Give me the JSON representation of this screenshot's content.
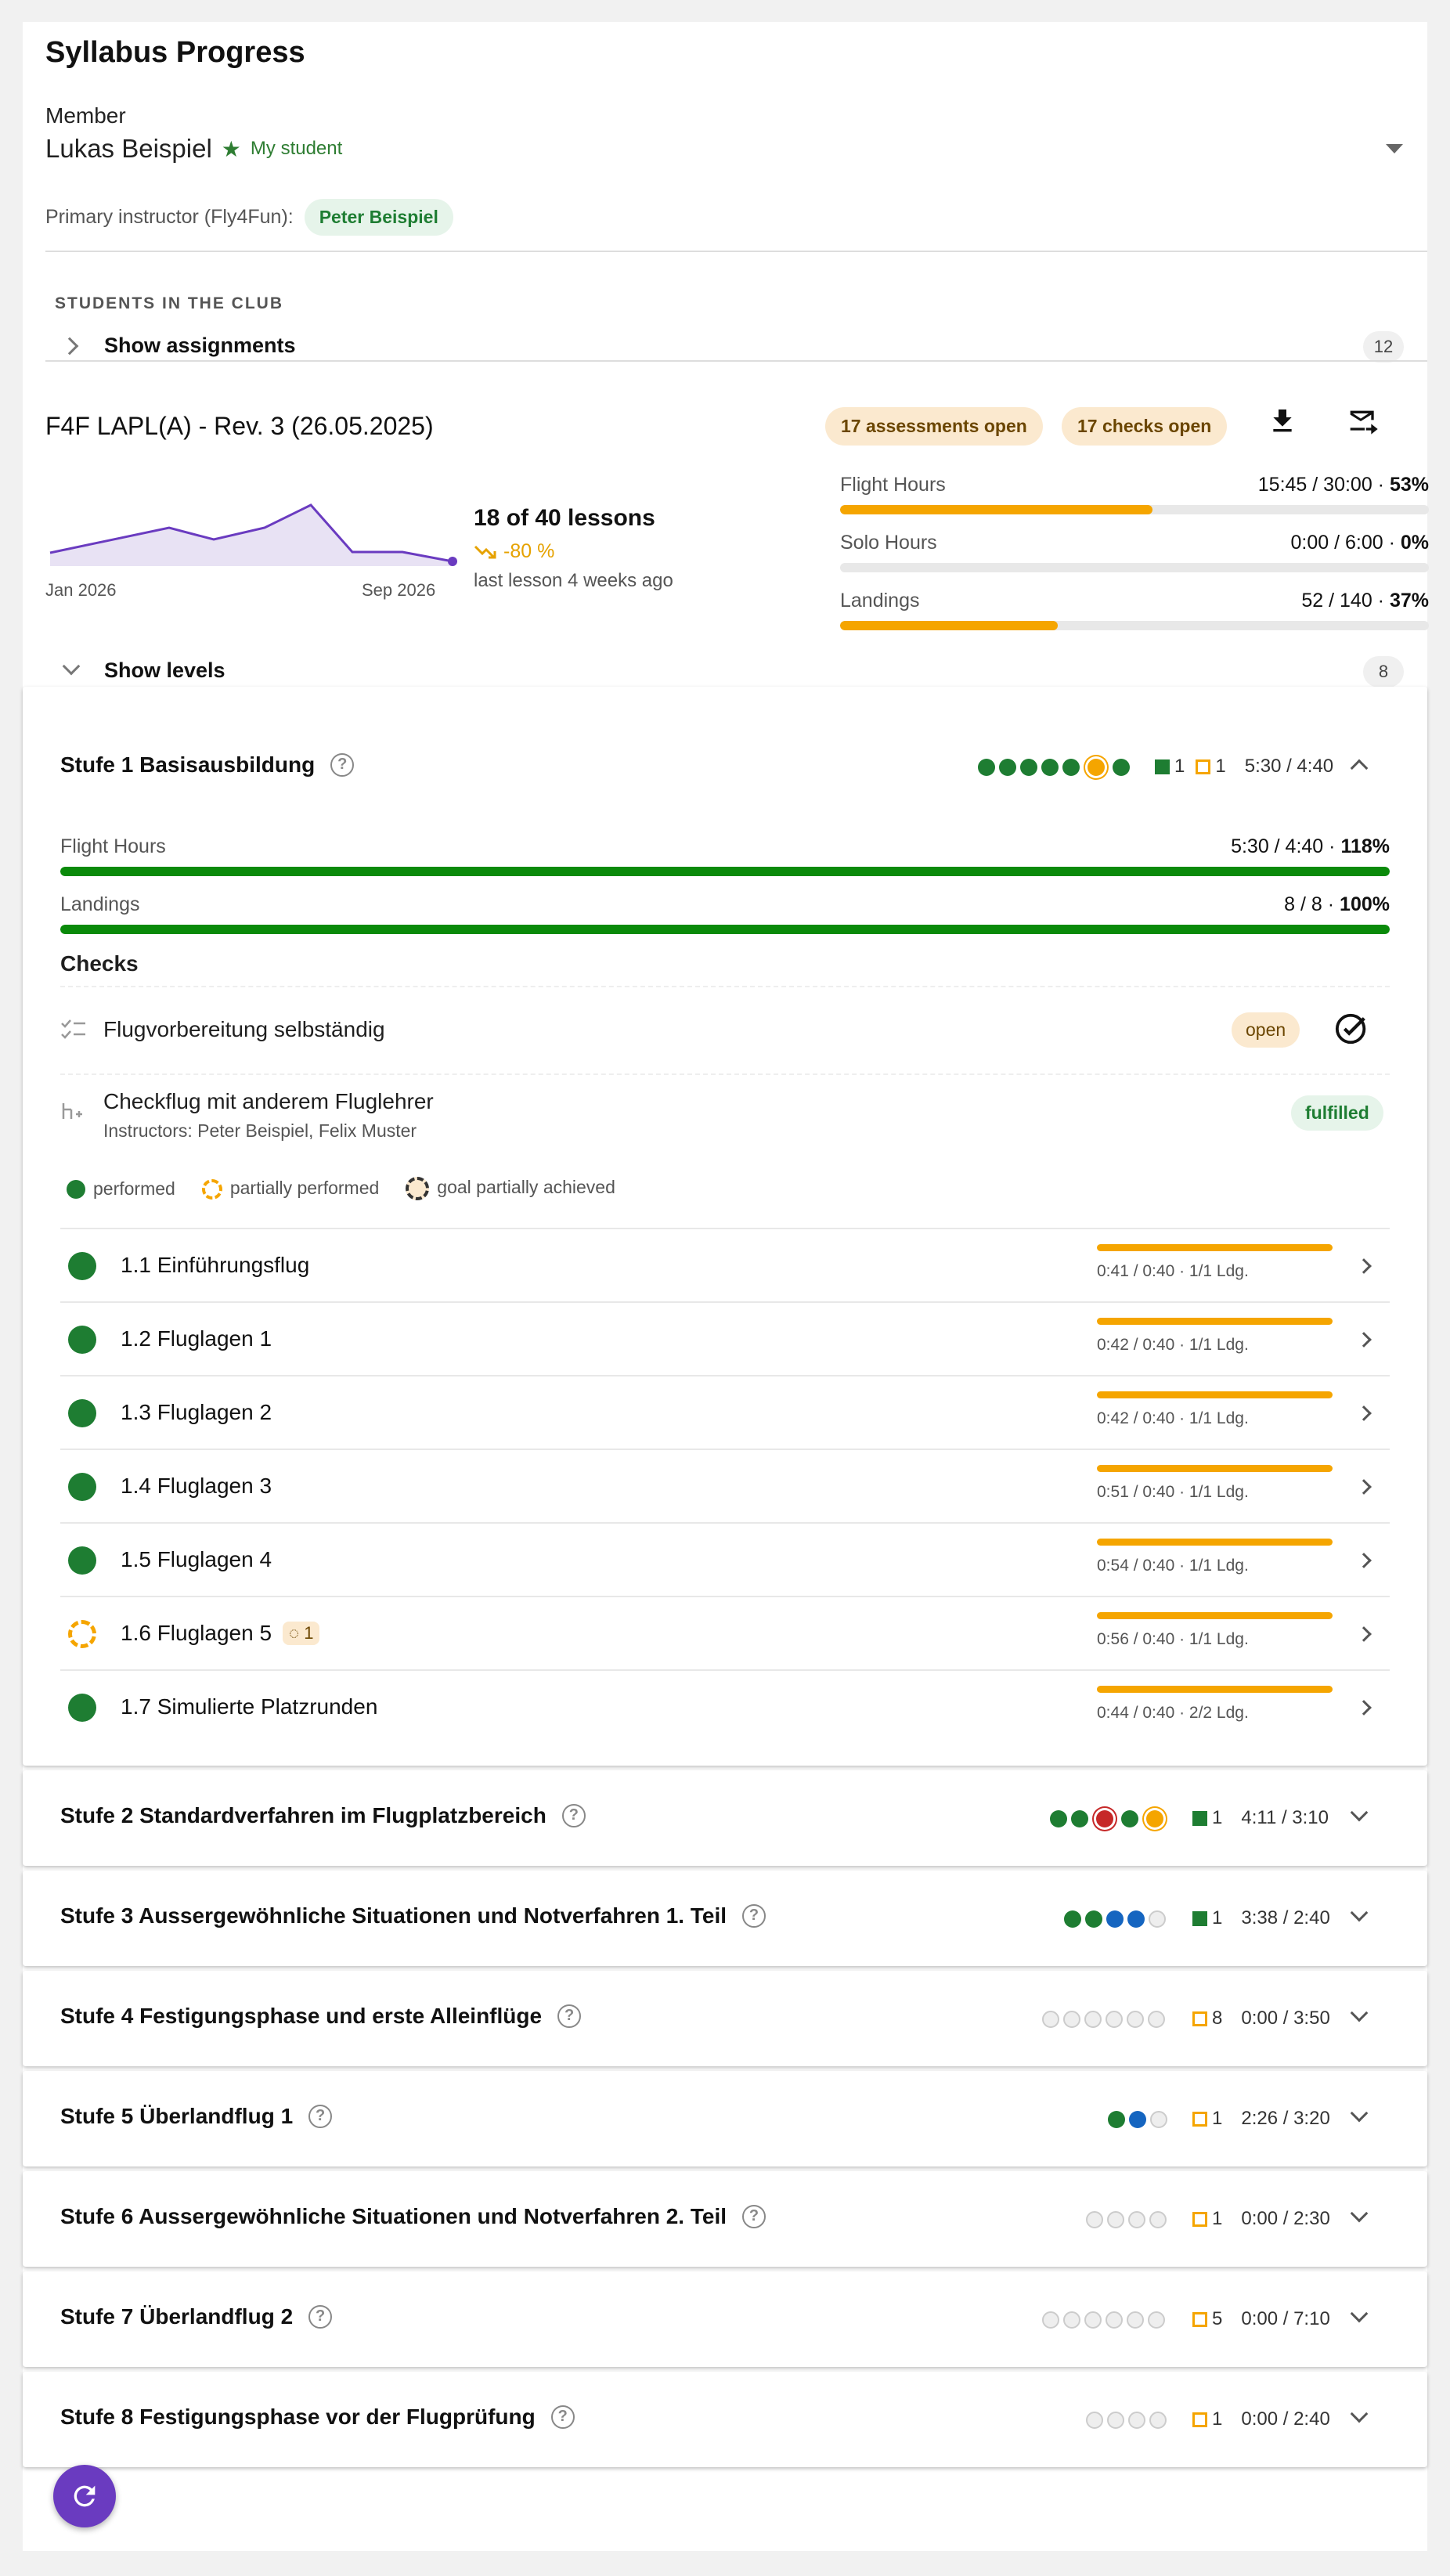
{
  "title": "Syllabus Progress",
  "member": {
    "label": "Member",
    "name": "Lukas Beispiel",
    "tag": "My student"
  },
  "primary": {
    "label": "Primary instructor (Fly4Fun):",
    "name": "Peter Beispiel"
  },
  "students": {
    "section": "STUDENTS IN THE CLUB",
    "toggle": "Show assignments",
    "count": "12"
  },
  "syllabus": {
    "title": "F4F LAPL(A) - Rev. 3 (26.05.2025)",
    "assessments_open": "17 assessments open",
    "checks_open": "17 checks open",
    "lessons": "18 of 40 lessons",
    "trend": "-80 %",
    "last_lesson": "last lesson 4 weeks ago",
    "chart": {
      "x_start": "Jan 2026",
      "x_end": "Sep 2026"
    },
    "stats": [
      {
        "label": "Flight Hours",
        "value": "15:45 / 30:00 · ",
        "pct": "53%",
        "fraction": 0.53
      },
      {
        "label": "Solo Hours",
        "value": "0:00 / 6:00 · ",
        "pct": "0%",
        "fraction": 0
      },
      {
        "label": "Landings",
        "value": "52 / 140 · ",
        "pct": "37%",
        "fraction": 0.37
      }
    ]
  },
  "levels_toggle": {
    "label": "Show levels",
    "count": "8"
  },
  "level1": {
    "title": "Stufe 1 Basisausbildung",
    "done": "1",
    "open": "1",
    "hours": "5:30 / 4:40",
    "flight_hours": {
      "label": "Flight Hours",
      "value": "5:30 / 4:40 · ",
      "pct": "118%"
    },
    "landings": {
      "label": "Landings",
      "value": "8 / 8 · ",
      "pct": "100%"
    },
    "checks_heading": "Checks",
    "checks": [
      {
        "name": "Flugvorbereitung selbständig",
        "status": "open"
      },
      {
        "name": "Checkflug mit anderem Fluglehrer",
        "sub": "Instructors: Peter Beispiel, Felix Muster",
        "status": "fulfilled"
      }
    ],
    "legend": [
      "performed",
      "partially performed",
      "goal partially achieved"
    ],
    "lessons": [
      {
        "name": "1.1 Einführungsflug",
        "sub": "0:41 / 0:40 · 1/1 Ldg.",
        "status": "done"
      },
      {
        "name": "1.2 Fluglagen 1",
        "sub": "0:42 / 0:40 · 1/1 Ldg.",
        "status": "done"
      },
      {
        "name": "1.3 Fluglagen 2",
        "sub": "0:42 / 0:40 · 1/1 Ldg.",
        "status": "done"
      },
      {
        "name": "1.4 Fluglagen 3",
        "sub": "0:51 / 0:40 · 1/1 Ldg.",
        "status": "done"
      },
      {
        "name": "1.5 Fluglagen 4",
        "sub": "0:54 / 0:40 · 1/1 Ldg.",
        "status": "done"
      },
      {
        "name": "1.6 Fluglagen 5",
        "sub": "0:56 / 0:40 · 1/1 Ldg.",
        "status": "partial",
        "goal": "1"
      },
      {
        "name": "1.7 Simulierte Platzrunden",
        "sub": "0:44 / 0:40 · 2/2 Ldg.",
        "status": "done"
      }
    ]
  },
  "levels": [
    {
      "title": "Stufe 2 Standardverfahren im Flugplatzbereich",
      "marker": "done",
      "count": "1",
      "hours": "4:11 / 3:10"
    },
    {
      "title": "Stufe 3 Aussergewöhnliche Situationen und Notverfahren 1. Teil",
      "marker": "done",
      "count": "1",
      "hours": "3:38 / 2:40"
    },
    {
      "title": "Stufe 4 Festigungsphase und erste Alleinflüge",
      "marker": "open",
      "count": "8",
      "hours": "0:00 / 3:50"
    },
    {
      "title": "Stufe 5 Überlandflug 1",
      "marker": "open",
      "count": "1",
      "hours": "2:26 / 3:20"
    },
    {
      "title": "Stufe 6 Aussergewöhnliche Situationen und Notverfahren 2. Teil",
      "marker": "open",
      "count": "1",
      "hours": "0:00 / 2:30"
    },
    {
      "title": "Stufe 7 Überlandflug 2",
      "marker": "open",
      "count": "5",
      "hours": "0:00 / 7:10"
    },
    {
      "title": "Stufe 8 Festigungsphase vor der Flugprüfung",
      "marker": "open",
      "count": "1",
      "hours": "0:00 / 2:40"
    }
  ],
  "colors": {
    "accent": "#6a3bc0",
    "green": "#1e7d32",
    "orange": "#f5a500",
    "blue": "#1565c0",
    "red": "#c62828"
  }
}
